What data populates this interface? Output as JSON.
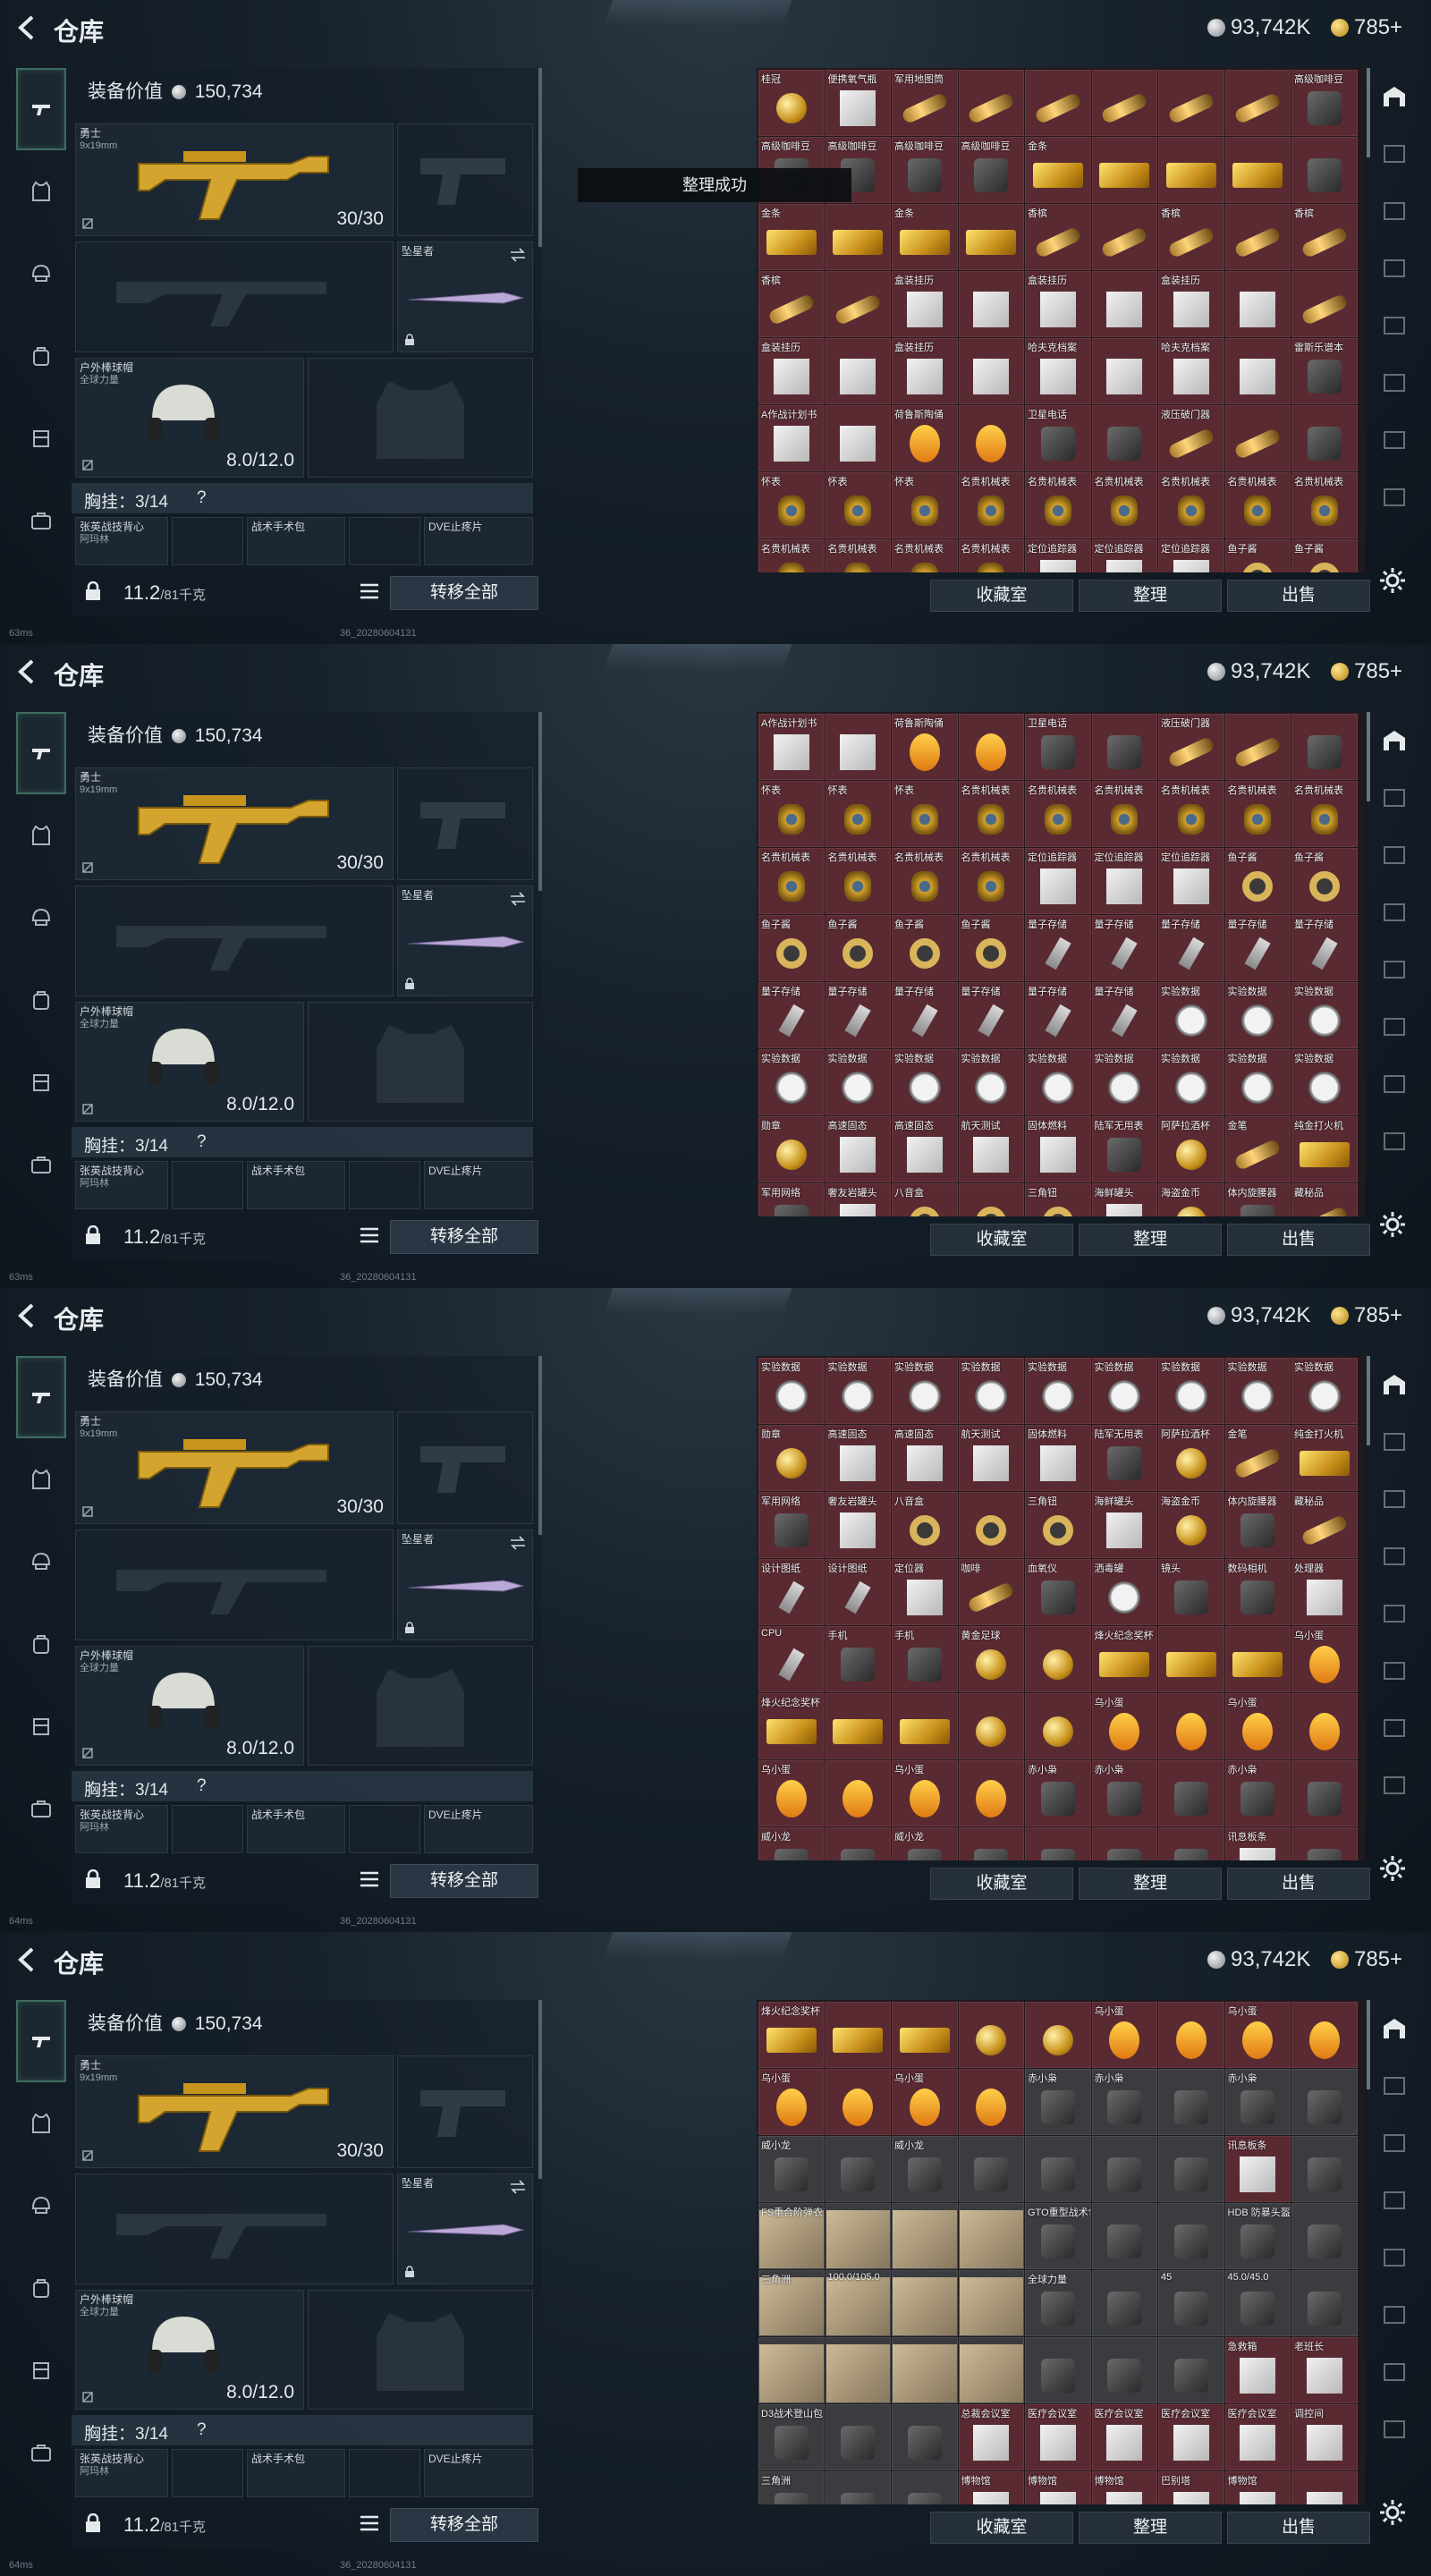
{
  "header": {
    "title": "仓库",
    "silver": "93,742K",
    "gold": "785+"
  },
  "equipment": {
    "value_label": "装备价值",
    "value": "150,734",
    "primary_weapon": {
      "name": "勇士",
      "ammo": "9x19mm",
      "count": "30/30"
    },
    "melee": {
      "name": "坠星者"
    },
    "helmet": {
      "name": "户外棒球帽",
      "sub": "全球力量",
      "durability": "8.0/12.0"
    },
    "chest_label": "胸挂：3/14",
    "pouches": [
      "张英战技背心",
      "战术手术包",
      "DVE止疼片"
    ],
    "pouch_sub": "阿玛林",
    "weight": "11.2",
    "weight_max": "/81千克",
    "transfer_all": "转移全部"
  },
  "toast": "整理成功",
  "stash_buttons": {
    "collection": "收藏室",
    "sort": "整理",
    "sell": "出售"
  },
  "frames": [
    {
      "status": "63ms",
      "timestamp": "36_20280604131",
      "items": [
        {
          "n": "桂冠",
          "t": "gold-round"
        },
        {
          "n": "便携氧气瓶",
          "t": "box"
        },
        {
          "n": "军用地图筒",
          "t": "bottle"
        },
        {
          "n": "",
          "t": "bottle"
        },
        {
          "n": "",
          "t": "bottle"
        },
        {
          "n": "",
          "t": "bottle"
        },
        {
          "n": "",
          "t": "bottle"
        },
        {
          "n": "",
          "t": "bottle"
        },
        {
          "n": "高级咖啡豆",
          "t": "dark"
        },
        {
          "n": "高级咖啡豆",
          "t": "dark"
        },
        {
          "n": "高级咖啡豆",
          "t": "dark"
        },
        {
          "n": "高级咖啡豆",
          "t": "dark"
        },
        {
          "n": "高级咖啡豆",
          "t": "dark"
        },
        {
          "n": "金条",
          "t": "bar"
        },
        {
          "n": "",
          "t": "bar"
        },
        {
          "n": "",
          "t": "bar"
        },
        {
          "n": "",
          "t": "bar"
        },
        {
          "n": "",
          "t": "dark"
        },
        {
          "n": "金条",
          "t": "bar"
        },
        {
          "n": "",
          "t": "bar"
        },
        {
          "n": "金条",
          "t": "bar"
        },
        {
          "n": "",
          "t": "bar"
        },
        {
          "n": "香槟",
          "t": "bottle"
        },
        {
          "n": "",
          "t": "bottle"
        },
        {
          "n": "香槟",
          "t": "bottle"
        },
        {
          "n": "",
          "t": "bottle"
        },
        {
          "n": "香槟",
          "t": "bottle"
        },
        {
          "n": "香槟",
          "t": "bottle"
        },
        {
          "n": "",
          "t": "bottle"
        },
        {
          "n": "盒装挂历",
          "t": "box"
        },
        {
          "n": "",
          "t": "box"
        },
        {
          "n": "盒装挂历",
          "t": "box"
        },
        {
          "n": "",
          "t": "box"
        },
        {
          "n": "盒装挂历",
          "t": "box"
        },
        {
          "n": "",
          "t": "box"
        },
        {
          "n": "",
          "t": "bottle"
        },
        {
          "n": "盒装挂历",
          "t": "box"
        },
        {
          "n": "",
          "t": "box"
        },
        {
          "n": "盒装挂历",
          "t": "box"
        },
        {
          "n": "",
          "t": "box"
        },
        {
          "n": "哈夫克档案",
          "t": "box"
        },
        {
          "n": "",
          "t": "box"
        },
        {
          "n": "哈夫克档案",
          "t": "box"
        },
        {
          "n": "",
          "t": "box"
        },
        {
          "n": "雷斯乐谱本",
          "t": "dark"
        },
        {
          "n": "A作战计划书",
          "t": "box"
        },
        {
          "n": "",
          "t": "box"
        },
        {
          "n": "荷鲁斯陶俑",
          "t": "egg"
        },
        {
          "n": "",
          "t": "egg"
        },
        {
          "n": "卫星电话",
          "t": "dark"
        },
        {
          "n": "",
          "t": "dark"
        },
        {
          "n": "液压破门器",
          "t": "bottle"
        },
        {
          "n": "",
          "t": "bottle"
        },
        {
          "n": "",
          "t": "dark"
        },
        {
          "n": "怀表",
          "t": "watch"
        },
        {
          "n": "怀表",
          "t": "watch"
        },
        {
          "n": "怀表",
          "t": "watch"
        },
        {
          "n": "名贵机械表",
          "t": "watch"
        },
        {
          "n": "名贵机械表",
          "t": "watch"
        },
        {
          "n": "名贵机械表",
          "t": "watch"
        },
        {
          "n": "名贵机械表",
          "t": "watch"
        },
        {
          "n": "名贵机械表",
          "t": "watch"
        },
        {
          "n": "名贵机械表",
          "t": "watch"
        },
        {
          "n": "名贵机械表",
          "t": "watch"
        },
        {
          "n": "名贵机械表",
          "t": "watch"
        },
        {
          "n": "名贵机械表",
          "t": "watch"
        },
        {
          "n": "名贵机械表",
          "t": "watch"
        },
        {
          "n": "定位追踪器",
          "t": "box"
        },
        {
          "n": "定位追踪器",
          "t": "box"
        },
        {
          "n": "定位追踪器",
          "t": "box"
        },
        {
          "n": "鱼子酱",
          "t": "ring"
        },
        {
          "n": "鱼子酱",
          "t": "ring"
        }
      ]
    },
    {
      "status": "63ms",
      "timestamp": "36_20280604131",
      "items": [
        {
          "n": "A作战计划书",
          "t": "box"
        },
        {
          "n": "",
          "t": "box"
        },
        {
          "n": "荷鲁斯陶俑",
          "t": "egg"
        },
        {
          "n": "",
          "t": "egg"
        },
        {
          "n": "卫星电话",
          "t": "dark"
        },
        {
          "n": "",
          "t": "dark"
        },
        {
          "n": "液压破门器",
          "t": "bottle"
        },
        {
          "n": "",
          "t": "bottle"
        },
        {
          "n": "",
          "t": "dark"
        },
        {
          "n": "怀表",
          "t": "watch"
        },
        {
          "n": "怀表",
          "t": "watch"
        },
        {
          "n": "怀表",
          "t": "watch"
        },
        {
          "n": "名贵机械表",
          "t": "watch"
        },
        {
          "n": "名贵机械表",
          "t": "watch"
        },
        {
          "n": "名贵机械表",
          "t": "watch"
        },
        {
          "n": "名贵机械表",
          "t": "watch"
        },
        {
          "n": "名贵机械表",
          "t": "watch"
        },
        {
          "n": "名贵机械表",
          "t": "watch"
        },
        {
          "n": "名贵机械表",
          "t": "watch"
        },
        {
          "n": "名贵机械表",
          "t": "watch"
        },
        {
          "n": "名贵机械表",
          "t": "watch"
        },
        {
          "n": "名贵机械表",
          "t": "watch"
        },
        {
          "n": "定位追踪器",
          "t": "box"
        },
        {
          "n": "定位追踪器",
          "t": "box"
        },
        {
          "n": "定位追踪器",
          "t": "box"
        },
        {
          "n": "鱼子酱",
          "t": "ring"
        },
        {
          "n": "鱼子酱",
          "t": "ring"
        },
        {
          "n": "鱼子酱",
          "t": "ring"
        },
        {
          "n": "鱼子酱",
          "t": "ring"
        },
        {
          "n": "鱼子酱",
          "t": "ring"
        },
        {
          "n": "鱼子酱",
          "t": "ring"
        },
        {
          "n": "量子存储",
          "t": "usb"
        },
        {
          "n": "量子存储",
          "t": "usb"
        },
        {
          "n": "量子存储",
          "t": "usb"
        },
        {
          "n": "量子存储",
          "t": "usb"
        },
        {
          "n": "量子存储",
          "t": "usb"
        },
        {
          "n": "量子存储",
          "t": "usb"
        },
        {
          "n": "量子存储",
          "t": "usb"
        },
        {
          "n": "量子存储",
          "t": "usb"
        },
        {
          "n": "量子存储",
          "t": "usb"
        },
        {
          "n": "量子存储",
          "t": "usb"
        },
        {
          "n": "量子存储",
          "t": "usb"
        },
        {
          "n": "实验数据",
          "t": "clock"
        },
        {
          "n": "实验数据",
          "t": "clock"
        },
        {
          "n": "实验数据",
          "t": "clock"
        },
        {
          "n": "实验数据",
          "t": "clock"
        },
        {
          "n": "实验数据",
          "t": "clock"
        },
        {
          "n": "实验数据",
          "t": "clock"
        },
        {
          "n": "实验数据",
          "t": "clock"
        },
        {
          "n": "实验数据",
          "t": "clock"
        },
        {
          "n": "实验数据",
          "t": "clock"
        },
        {
          "n": "实验数据",
          "t": "clock"
        },
        {
          "n": "实验数据",
          "t": "clock"
        },
        {
          "n": "实验数据",
          "t": "clock"
        },
        {
          "n": "勋章",
          "t": "gold-round"
        },
        {
          "n": "高速固态",
          "t": "box"
        },
        {
          "n": "高速固态",
          "t": "box"
        },
        {
          "n": "航天测试",
          "t": "box"
        },
        {
          "n": "固体燃料",
          "t": "box"
        },
        {
          "n": "陆军无用表",
          "t": "dark"
        },
        {
          "n": "阿萨拉酒杯",
          "t": "gold-round"
        },
        {
          "n": "金笔",
          "t": "bottle"
        },
        {
          "n": "纯金打火机",
          "t": "bar"
        },
        {
          "n": "军用网络",
          "t": "dark"
        },
        {
          "n": "奢友岩罐头",
          "t": "box"
        },
        {
          "n": "八音盒",
          "t": "ring"
        },
        {
          "n": "",
          "t": "ring"
        },
        {
          "n": "三角钮",
          "t": "ring"
        },
        {
          "n": "海鲜罐头",
          "t": "box"
        },
        {
          "n": "海盗金币",
          "t": "gold-round"
        },
        {
          "n": "体内旋腰器",
          "t": "dark"
        },
        {
          "n": "藏秘品",
          "t": "bottle"
        }
      ]
    },
    {
      "status": "64ms",
      "timestamp": "36_20280604131",
      "items": [
        {
          "n": "实验数据",
          "t": "clock"
        },
        {
          "n": "实验数据",
          "t": "clock"
        },
        {
          "n": "实验数据",
          "t": "clock"
        },
        {
          "n": "实验数据",
          "t": "clock"
        },
        {
          "n": "实验数据",
          "t": "clock"
        },
        {
          "n": "实验数据",
          "t": "clock"
        },
        {
          "n": "实验数据",
          "t": "clock"
        },
        {
          "n": "实验数据",
          "t": "clock"
        },
        {
          "n": "实验数据",
          "t": "clock"
        },
        {
          "n": "勋章",
          "t": "gold-round"
        },
        {
          "n": "高速固态",
          "t": "box"
        },
        {
          "n": "高速固态",
          "t": "box"
        },
        {
          "n": "航天测试",
          "t": "box"
        },
        {
          "n": "固体燃料",
          "t": "box"
        },
        {
          "n": "陆军无用表",
          "t": "dark"
        },
        {
          "n": "阿萨拉酒杯",
          "t": "gold-round"
        },
        {
          "n": "金笔",
          "t": "bottle"
        },
        {
          "n": "纯金打火机",
          "t": "bar"
        },
        {
          "n": "军用网络",
          "t": "dark"
        },
        {
          "n": "奢友岩罐头",
          "t": "box"
        },
        {
          "n": "八音盒",
          "t": "ring"
        },
        {
          "n": "",
          "t": "ring"
        },
        {
          "n": "三角钮",
          "t": "ring"
        },
        {
          "n": "海鲜罐头",
          "t": "box"
        },
        {
          "n": "海盗金币",
          "t": "gold-round"
        },
        {
          "n": "体内旋腰器",
          "t": "dark"
        },
        {
          "n": "藏秘品",
          "t": "bottle"
        },
        {
          "n": "设计图纸",
          "t": "usb"
        },
        {
          "n": "设计图纸",
          "t": "usb"
        },
        {
          "n": "定位器",
          "t": "box"
        },
        {
          "n": "咖啡",
          "t": "bottle"
        },
        {
          "n": "血氧仪",
          "t": "dark"
        },
        {
          "n": "洒毒罐",
          "t": "clock"
        },
        {
          "n": "镜头",
          "t": "dark"
        },
        {
          "n": "数码相机",
          "t": "dark"
        },
        {
          "n": "处理器",
          "t": "box"
        },
        {
          "n": "CPU",
          "t": "usb"
        },
        {
          "n": "手机",
          "t": "dark"
        },
        {
          "n": "手机",
          "t": "dark"
        },
        {
          "n": "黄金足球",
          "t": "gold-round"
        },
        {
          "n": "",
          "t": "gold-round"
        },
        {
          "n": "烽火纪念奖杯",
          "t": "bar"
        },
        {
          "n": "",
          "t": "bar"
        },
        {
          "n": "",
          "t": "bar"
        },
        {
          "n": "乌小蛋",
          "t": "egg"
        },
        {
          "n": "烽火纪念奖杯",
          "t": "bar"
        },
        {
          "n": "",
          "t": "bar"
        },
        {
          "n": "",
          "t": "bar"
        },
        {
          "n": "",
          "t": "gold-round"
        },
        {
          "n": "",
          "t": "gold-round"
        },
        {
          "n": "乌小蛋",
          "t": "egg"
        },
        {
          "n": "",
          "t": "egg"
        },
        {
          "n": "乌小蛋",
          "t": "egg"
        },
        {
          "n": "",
          "t": "egg"
        },
        {
          "n": "乌小蛋",
          "t": "egg"
        },
        {
          "n": "",
          "t": "egg"
        },
        {
          "n": "乌小蛋",
          "t": "egg"
        },
        {
          "n": "",
          "t": "egg"
        },
        {
          "n": "赤小枭",
          "t": "dark"
        },
        {
          "n": "赤小枭",
          "t": "dark"
        },
        {
          "n": "",
          "t": "dark"
        },
        {
          "n": "赤小枭",
          "t": "dark"
        },
        {
          "n": "",
          "t": "dark"
        },
        {
          "n": "威小龙",
          "t": "dark"
        },
        {
          "n": "",
          "t": "dark"
        },
        {
          "n": "威小龙",
          "t": "dark"
        },
        {
          "n": "",
          "t": "dark"
        },
        {
          "n": "",
          "t": "dark"
        },
        {
          "n": "",
          "t": "dark"
        },
        {
          "n": "",
          "t": "dark"
        },
        {
          "n": "讯息板条",
          "t": "box"
        },
        {
          "n": "",
          "t": "dark"
        }
      ]
    },
    {
      "status": "64ms",
      "timestamp": "36_20280604131",
      "items": [
        {
          "n": "烽火纪念奖杯",
          "t": "bar"
        },
        {
          "n": "",
          "t": "bar"
        },
        {
          "n": "",
          "t": "bar"
        },
        {
          "n": "",
          "t": "gold-round"
        },
        {
          "n": "",
          "t": "gold-round"
        },
        {
          "n": "乌小蛋",
          "t": "egg"
        },
        {
          "n": "",
          "t": "egg"
        },
        {
          "n": "乌小蛋",
          "t": "egg"
        },
        {
          "n": "",
          "t": "egg"
        },
        {
          "n": "乌小蛋",
          "t": "egg"
        },
        {
          "n": "",
          "t": "egg"
        },
        {
          "n": "乌小蛋",
          "t": "egg"
        },
        {
          "n": "",
          "t": "egg"
        },
        {
          "n": "赤小枭",
          "t": "dark"
        },
        {
          "n": "赤小枭",
          "t": "dark"
        },
        {
          "n": "",
          "t": "dark"
        },
        {
          "n": "赤小枭",
          "t": "dark"
        },
        {
          "n": "",
          "t": "dark"
        },
        {
          "n": "威小龙",
          "t": "dark"
        },
        {
          "n": "",
          "t": "dark"
        },
        {
          "n": "威小龙",
          "t": "dark"
        },
        {
          "n": "",
          "t": "dark"
        },
        {
          "n": "",
          "t": "dark"
        },
        {
          "n": "",
          "t": "dark"
        },
        {
          "n": "",
          "t": "dark"
        },
        {
          "n": "讯息板条",
          "t": "box"
        },
        {
          "n": "",
          "t": "dark"
        },
        {
          "n": "FS重合阶弹衣",
          "t": "big"
        },
        {
          "n": "",
          "t": "big"
        },
        {
          "n": "",
          "t": "big"
        },
        {
          "n": "",
          "t": "big"
        },
        {
          "n": "GTO重型战术包",
          "t": "dark"
        },
        {
          "n": "",
          "t": "dark"
        },
        {
          "n": "",
          "t": "dark"
        },
        {
          "n": "HDB 防暴头盔",
          "t": "dark"
        },
        {
          "n": "",
          "t": "dark"
        },
        {
          "n": "三角洲",
          "t": "big"
        },
        {
          "n": "100.0/105.0",
          "t": "big"
        },
        {
          "n": "",
          "t": "big"
        },
        {
          "n": "",
          "t": "big"
        },
        {
          "n": "全球力量",
          "t": "dark"
        },
        {
          "n": "",
          "t": "dark"
        },
        {
          "n": "45",
          "t": "dark"
        },
        {
          "n": "45.0/45.0",
          "t": "dark"
        },
        {
          "n": "",
          "t": "dark"
        },
        {
          "n": "",
          "t": "big"
        },
        {
          "n": "",
          "t": "big"
        },
        {
          "n": "",
          "t": "big"
        },
        {
          "n": "",
          "t": "big"
        },
        {
          "n": "",
          "t": "dark"
        },
        {
          "n": "",
          "t": "dark"
        },
        {
          "n": "",
          "t": "dark"
        },
        {
          "n": "急救箱",
          "t": "box"
        },
        {
          "n": "老班长",
          "t": "box"
        },
        {
          "n": "D3战术登山包",
          "t": "dark"
        },
        {
          "n": "",
          "t": "dark"
        },
        {
          "n": "",
          "t": "dark"
        },
        {
          "n": "总裁会议室",
          "t": "box"
        },
        {
          "n": "医疗会议室",
          "t": "box"
        },
        {
          "n": "医疗会议室",
          "t": "box"
        },
        {
          "n": "医疗会议室",
          "t": "box"
        },
        {
          "n": "医疗会议室",
          "t": "box"
        },
        {
          "n": "调控间",
          "t": "box"
        },
        {
          "n": "三角洲",
          "t": "dark"
        },
        {
          "n": "",
          "t": "dark"
        },
        {
          "n": "",
          "t": "dark"
        },
        {
          "n": "博物馆",
          "t": "box"
        },
        {
          "n": "博物馆",
          "t": "box"
        },
        {
          "n": "博物馆",
          "t": "box"
        },
        {
          "n": "巴别塔",
          "t": "box"
        },
        {
          "n": "博物馆",
          "t": "box"
        },
        {
          "n": "",
          "t": "box"
        }
      ]
    }
  ]
}
